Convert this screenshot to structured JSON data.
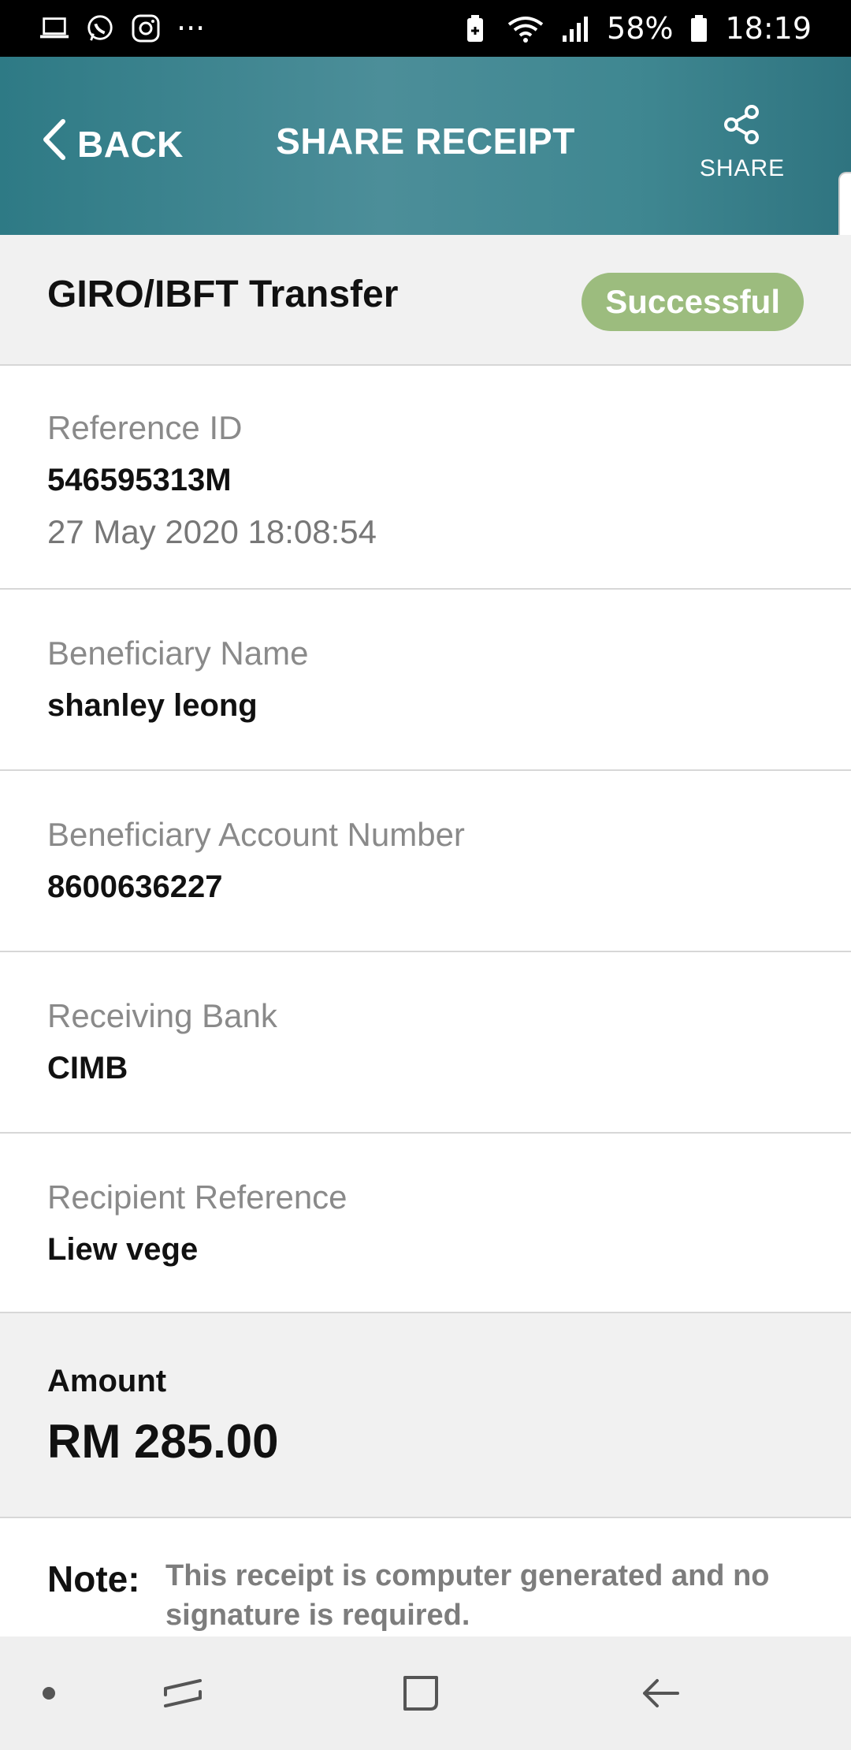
{
  "status_bar": {
    "battery": "58%",
    "time": "18:19",
    "more": "···"
  },
  "header": {
    "back_label": "BACK",
    "title": "SHARE RECEIPT",
    "share_label": "SHARE"
  },
  "summary": {
    "type": "GIRO/IBFT Transfer",
    "status": "Successful",
    "status_color": "#9cbc7e"
  },
  "details": [
    {
      "label": "Reference ID",
      "value": "546595313M",
      "sub": "27 May 2020 18:08:54"
    },
    {
      "label": "Beneficiary Name",
      "value": "shanley leong"
    },
    {
      "label": "Beneficiary Account Number",
      "value": "8600636227"
    },
    {
      "label": "Receiving Bank",
      "value": "CIMB"
    },
    {
      "label": "Recipient Reference",
      "value": "Liew vege"
    }
  ],
  "amount": {
    "label": "Amount",
    "value": "RM 285.00"
  },
  "note": {
    "label": "Note:",
    "text": "This receipt is computer generated and no signature is required."
  },
  "colors": {
    "header_teal": "#3f8791",
    "badge_green": "#9cbc7e"
  }
}
